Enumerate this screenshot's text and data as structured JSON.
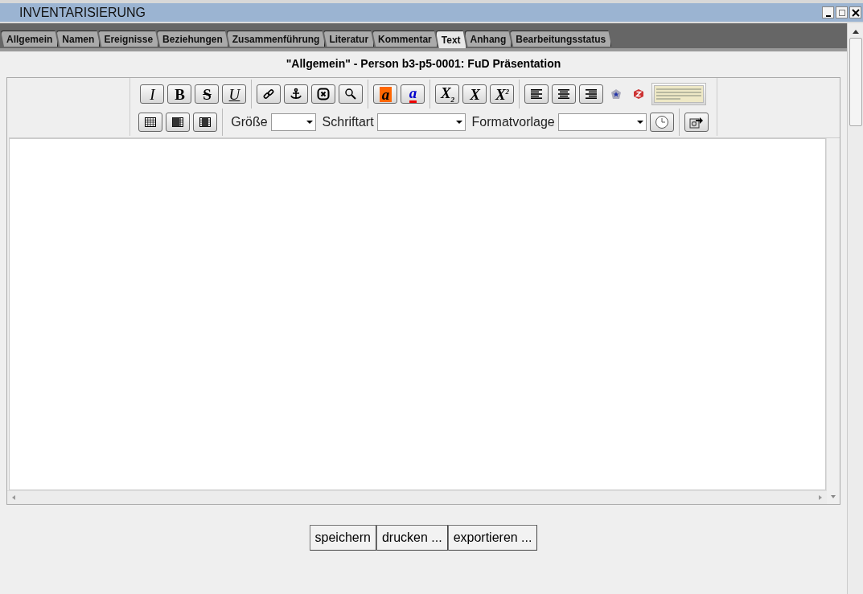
{
  "window": {
    "title": "INVENTARISIERUNG"
  },
  "tabs": [
    {
      "label": "Allgemein",
      "selected": false
    },
    {
      "label": "Namen",
      "selected": false
    },
    {
      "label": "Ereignisse",
      "selected": false
    },
    {
      "label": "Beziehungen",
      "selected": false
    },
    {
      "label": "Zusammenführung",
      "selected": false
    },
    {
      "label": "Literatur",
      "selected": false
    },
    {
      "label": "Kommentar",
      "selected": false
    },
    {
      "label": "Text",
      "selected": true
    },
    {
      "label": "Anhang",
      "selected": false
    },
    {
      "label": "Bearbeitungsstatus",
      "selected": false
    }
  ],
  "heading": "\"Allgemein\" - Person b3-p5-0001: FuD Präsentation",
  "format_buttons": [
    "I",
    "B",
    "S",
    "U"
  ],
  "color_buttons": [
    "a",
    "a"
  ],
  "script_buttons": [
    "X$_{2}$",
    "X",
    "X$^{2}$"
  ],
  "selects": [
    {
      "label": "Größe"
    },
    {
      "label": "Schriftart"
    },
    {
      "label": "Formatvorlage"
    }
  ],
  "buttons": [
    "speichern",
    "drucken ...",
    "exportieren ..."
  ]
}
